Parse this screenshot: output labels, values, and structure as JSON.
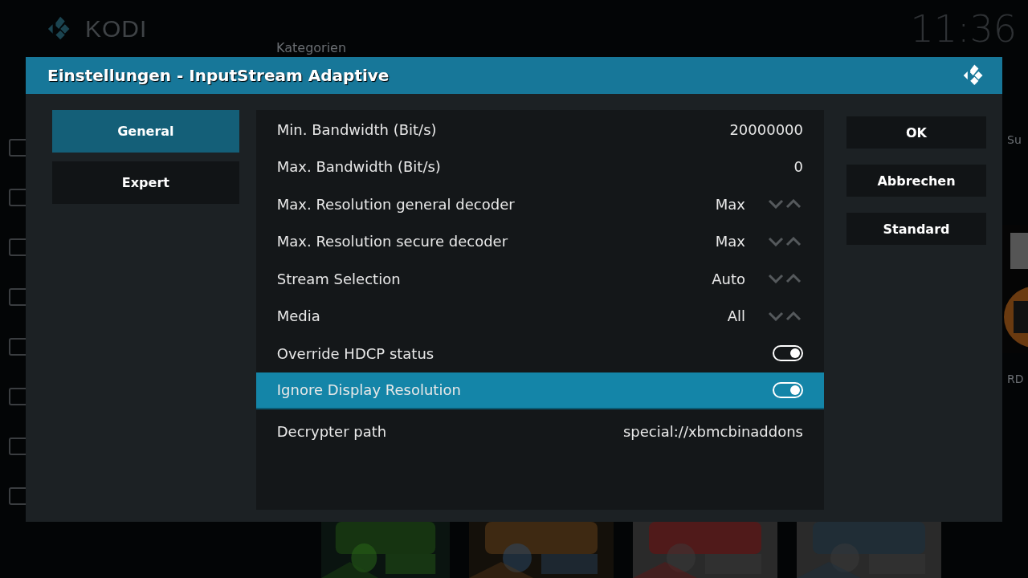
{
  "background": {
    "logo_text": "KODI",
    "clock": "11:36",
    "section_heading": "Kategorien",
    "right_edge_texts": [
      "Su",
      "RD"
    ],
    "tiles": [
      {
        "kind": "picture"
      },
      {
        "kind": "picture"
      },
      {
        "kind": "picture"
      },
      {
        "kind": "picture"
      }
    ]
  },
  "dialog": {
    "title": "Einstellungen - InputStream Adaptive",
    "categories": [
      {
        "label": "General",
        "selected": true
      },
      {
        "label": "Expert",
        "selected": false
      }
    ],
    "settings": [
      {
        "kind": "value",
        "label": "Min. Bandwidth (Bit/s)",
        "value": "20000000",
        "selected": false
      },
      {
        "kind": "value",
        "label": "Max. Bandwidth (Bit/s)",
        "value": "0",
        "selected": false
      },
      {
        "kind": "spinner",
        "label": "Max. Resolution general decoder",
        "value": "Max",
        "selected": false
      },
      {
        "kind": "spinner",
        "label": "Max. Resolution secure decoder",
        "value": "Max",
        "selected": false
      },
      {
        "kind": "spinner",
        "label": "Stream Selection",
        "value": "Auto",
        "selected": false
      },
      {
        "kind": "spinner",
        "label": "Media",
        "value": "All",
        "selected": false
      },
      {
        "kind": "toggle",
        "label": "Override HDCP status",
        "on": true,
        "selected": false
      },
      {
        "kind": "toggle",
        "label": "Ignore Display Resolution",
        "on": true,
        "selected": true
      },
      {
        "kind": "value",
        "label": "Decrypter path",
        "value": "special://xbmcbinaddons",
        "selected": false
      }
    ],
    "buttons": [
      "OK",
      "Abbrechen",
      "Standard"
    ]
  }
}
